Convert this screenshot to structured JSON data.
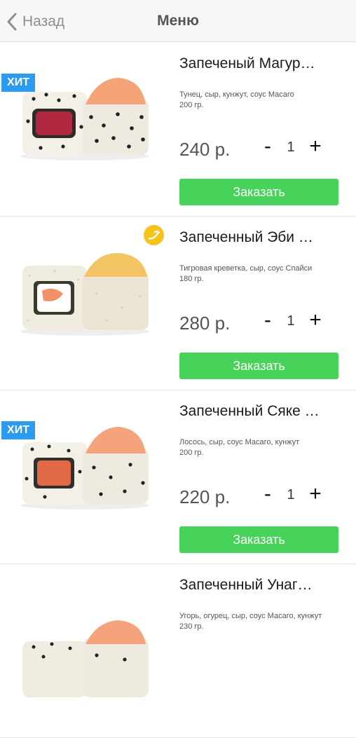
{
  "nav": {
    "back_label": "Назад",
    "title": "Меню"
  },
  "colors": {
    "accent_green": "#47d35a",
    "hit_badge": "#2a9bf0",
    "hot_badge": "#f7c21a"
  },
  "products": [
    {
      "name": "Запеченый Магур…",
      "desc_line1": "Тунец, сыр, кунжут, соус Масаго",
      "desc_line2": "200 гр.",
      "price": "240 р.",
      "quantity": "1",
      "order_label": "Заказать",
      "badge": "ХИТ",
      "filling": "tuna"
    },
    {
      "name": "Запеченный Эби …",
      "desc_line1": "Тигровая креветка, сыр, соус Спайси",
      "desc_line2": "180 гр.",
      "price": "280 р.",
      "quantity": "1",
      "order_label": "Заказать",
      "badge_icon": "spicy-icon",
      "filling": "shrimp"
    },
    {
      "name": "Запеченный Сяке …",
      "desc_line1": "Лосось, сыр, соус Масаго, кунжут",
      "desc_line2": "200 гр.",
      "price": "220 р.",
      "quantity": "1",
      "order_label": "Заказать",
      "badge": "ХИТ",
      "filling": "salmon"
    },
    {
      "name": "Запеченный Унаг…",
      "desc_line1": "Угорь, огурец, сыр, соус Масаго, кунжут",
      "desc_line2": "230 гр.",
      "filling": "eel"
    }
  ]
}
